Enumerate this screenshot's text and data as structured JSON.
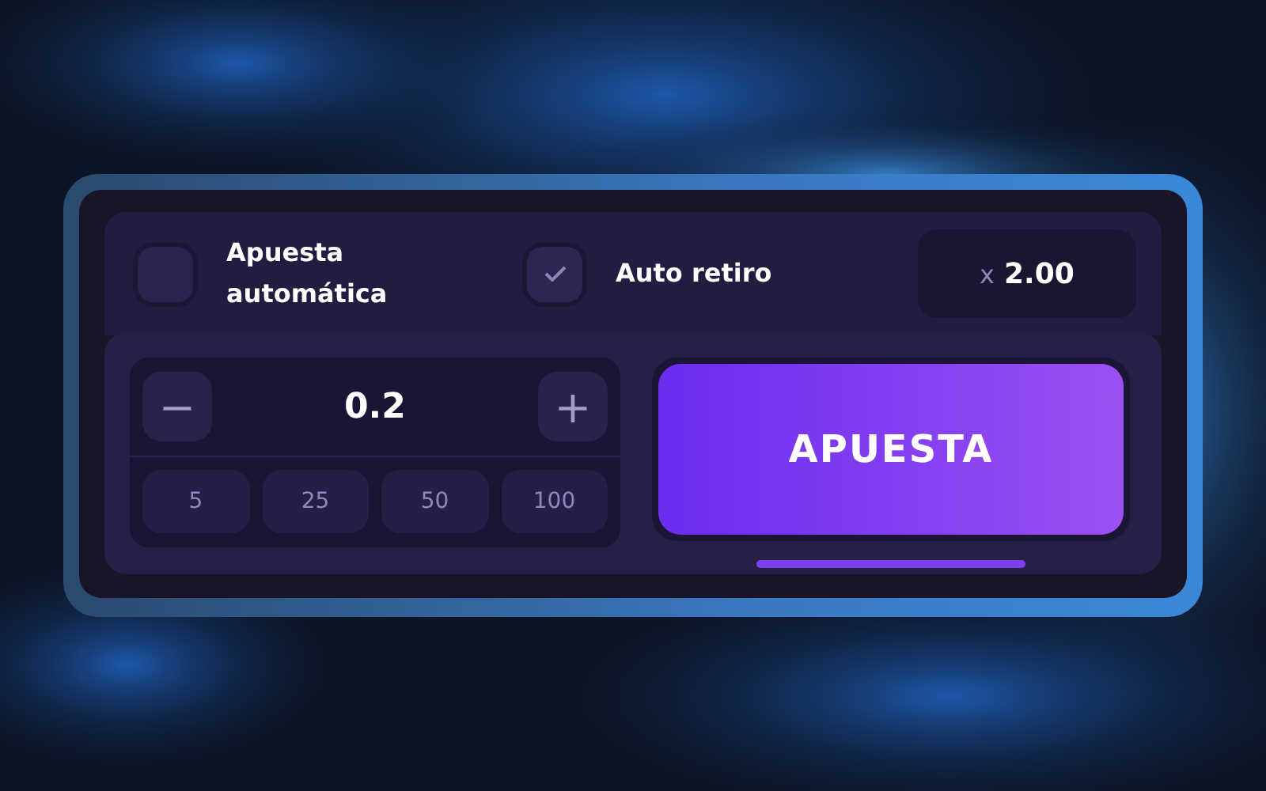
{
  "auto_bet": {
    "label": "Apuesta automática",
    "checked": false
  },
  "auto_cashout": {
    "label": "Auto retiro",
    "checked": true,
    "prefix": "x",
    "value": "2.00"
  },
  "stake": {
    "minus": "−",
    "value": "0.2",
    "plus": "+"
  },
  "quick_amounts": [
    "5",
    "25",
    "50",
    "100"
  ],
  "bet_button": {
    "label": "APUESTA"
  }
}
